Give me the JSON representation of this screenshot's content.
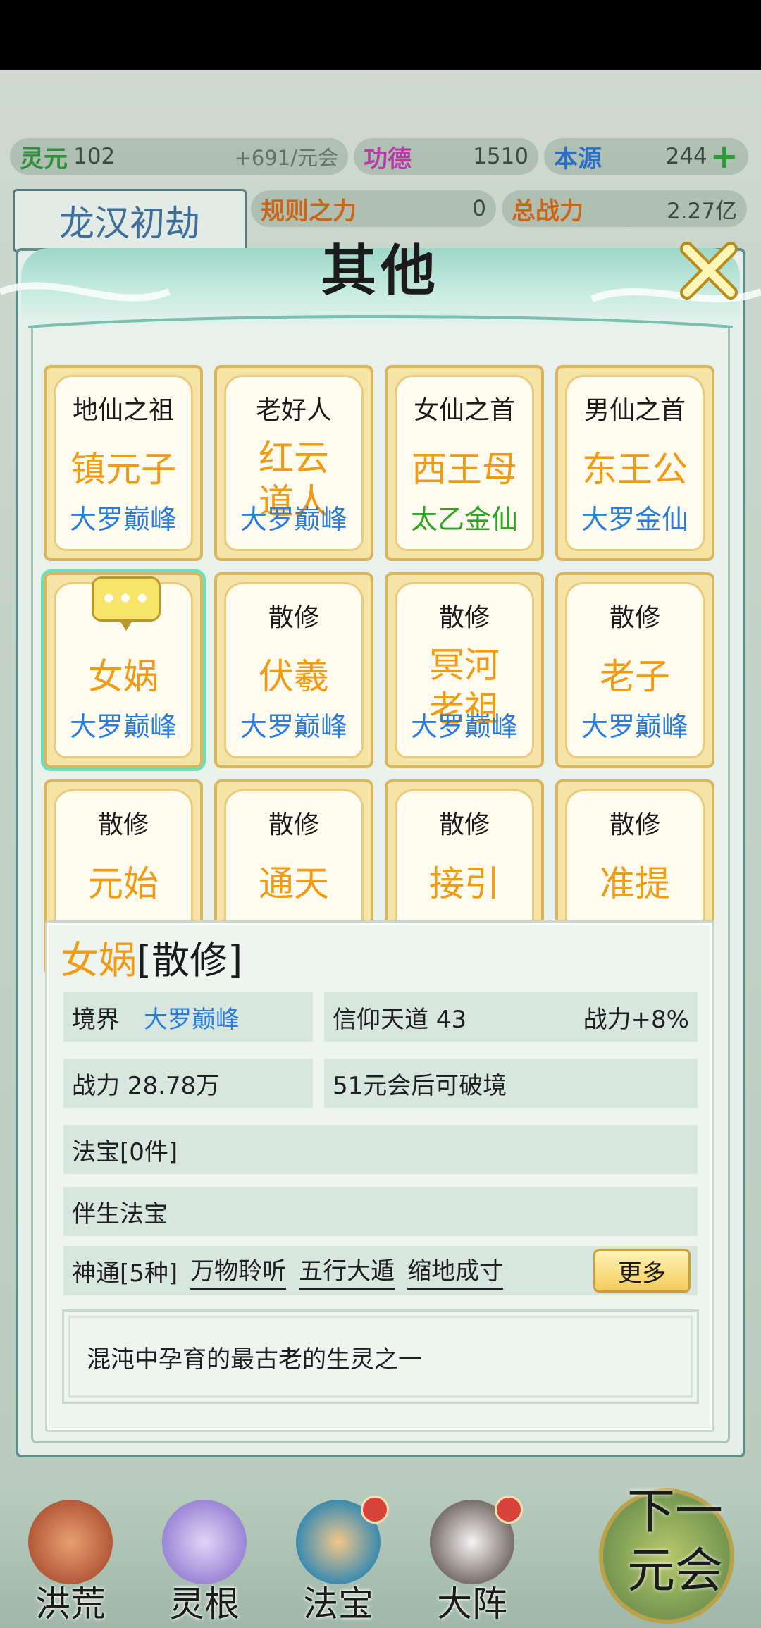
{
  "resources": {
    "lingyuan_label": "灵元",
    "lingyuan_value": "102",
    "lingyuan_rate": "+691/元会",
    "gongde_label": "功德",
    "gongde_value": "1510",
    "benyuan_label": "本源",
    "benyuan_value": "244",
    "guize_label": "规则之力",
    "guize_value": "0",
    "zhanli_label": "总战力",
    "zhanli_value": "2.27亿"
  },
  "stage_title": "龙汉初劫",
  "modal": {
    "title": "其他",
    "cards": [
      {
        "role": "地仙之祖",
        "name": "镇元子",
        "realm": "大罗巅峰",
        "realm_color": "blue"
      },
      {
        "role": "老好人",
        "name": "红云\n道人",
        "realm": "大罗巅峰",
        "realm_color": "blue"
      },
      {
        "role": "女仙之首",
        "name": "西王母",
        "realm": "太乙金仙",
        "realm_color": "green"
      },
      {
        "role": "男仙之首",
        "name": "东王公",
        "realm": "大罗金仙",
        "realm_color": "blue"
      },
      {
        "role": "",
        "name": "女娲",
        "realm": "大罗巅峰",
        "realm_color": "blue"
      },
      {
        "role": "散修",
        "name": "伏羲",
        "realm": "大罗巅峰",
        "realm_color": "blue"
      },
      {
        "role": "散修",
        "name": "冥河\n老祖",
        "realm": "大罗巅峰",
        "realm_color": "blue"
      },
      {
        "role": "散修",
        "name": "老子",
        "realm": "大罗巅峰",
        "realm_color": "blue"
      },
      {
        "role": "散修",
        "name": "元始",
        "realm": "",
        "realm_color": "blue"
      },
      {
        "role": "散修",
        "name": "通天",
        "realm": "",
        "realm_color": "blue"
      },
      {
        "role": "散修",
        "name": "接引",
        "realm": "",
        "realm_color": "blue"
      },
      {
        "role": "散修",
        "name": "准提",
        "realm": "",
        "realm_color": "blue"
      }
    ],
    "bubble": "•••"
  },
  "detail": {
    "name": "女娲",
    "tag": "[散修]",
    "jingjie_label": "境界",
    "jingjie_value": "大罗巅峰",
    "xinyang": "信仰天道  43",
    "xinyang_bonus": "战力+8%",
    "zhanli": "战力 28.78万",
    "pojing": "51元会后可破境",
    "fabao": "法宝[0件]",
    "bansheng": "伴生法宝",
    "shentong_label": "神通[5种]",
    "shentong": [
      "万物聆听",
      "五行大遁",
      "缩地成寸"
    ],
    "more_label": "更多",
    "description": "混沌中孕育的最古老的生灵之一"
  },
  "nav": {
    "items": [
      "洪荒",
      "灵根",
      "法宝",
      "大阵"
    ],
    "next_line1": "下一",
    "next_line2": "元会"
  },
  "colors": {
    "name_orange": "#f19a13",
    "realm_blue": "#2a7de0",
    "realm_green": "#2fa424",
    "panel_teal": "#5f8f86"
  }
}
